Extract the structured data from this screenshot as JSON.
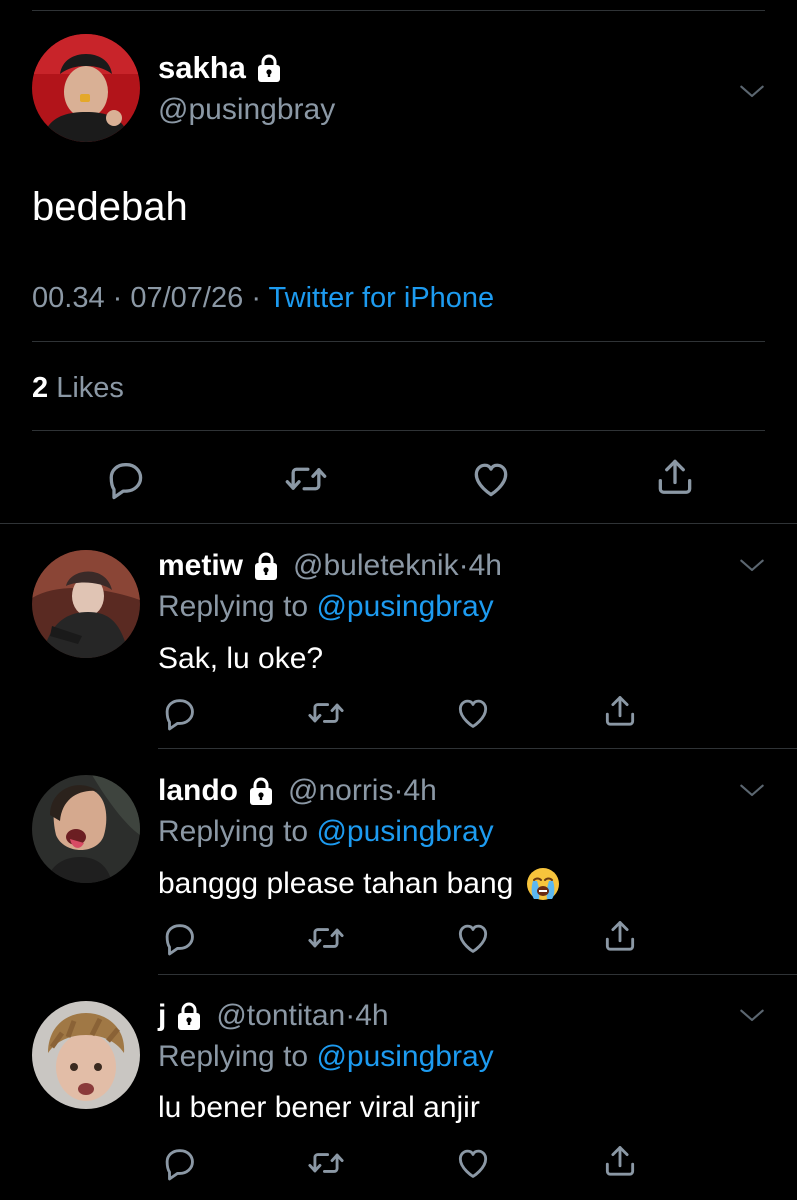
{
  "main_tweet": {
    "display_name": "sakha",
    "handle": "@pusingbray",
    "text": "bedebah",
    "time": "00.34",
    "date": "07/07/26",
    "source": "Twitter for iPhone",
    "likes_count": "2",
    "likes_label": "Likes"
  },
  "replies": [
    {
      "display_name": "metiw",
      "handle": "@buleteknik",
      "time": "4h",
      "replying_label": "Replying to",
      "replying_to": "@pusingbray",
      "text": "Sak, lu oke?"
    },
    {
      "display_name": "lando",
      "handle": "@norris",
      "time": "4h",
      "replying_label": "Replying to",
      "replying_to": "@pusingbray",
      "text": "banggg please tahan bang",
      "emoji": "loudly-crying-face"
    },
    {
      "display_name": "j",
      "handle": "@tontitan",
      "time": "4h",
      "replying_label": "Replying to",
      "replying_to": "@pusingbray",
      "text": "lu bener bener viral anjir"
    }
  ],
  "colors": {
    "background": "#000000",
    "text": "#ffffff",
    "secondary": "#8b98a5",
    "link": "#1d9bf0",
    "divider": "#2f3336"
  },
  "icons": [
    "lock-icon",
    "chevron-down-icon",
    "reply-icon",
    "retweet-icon",
    "like-icon",
    "share-icon"
  ]
}
